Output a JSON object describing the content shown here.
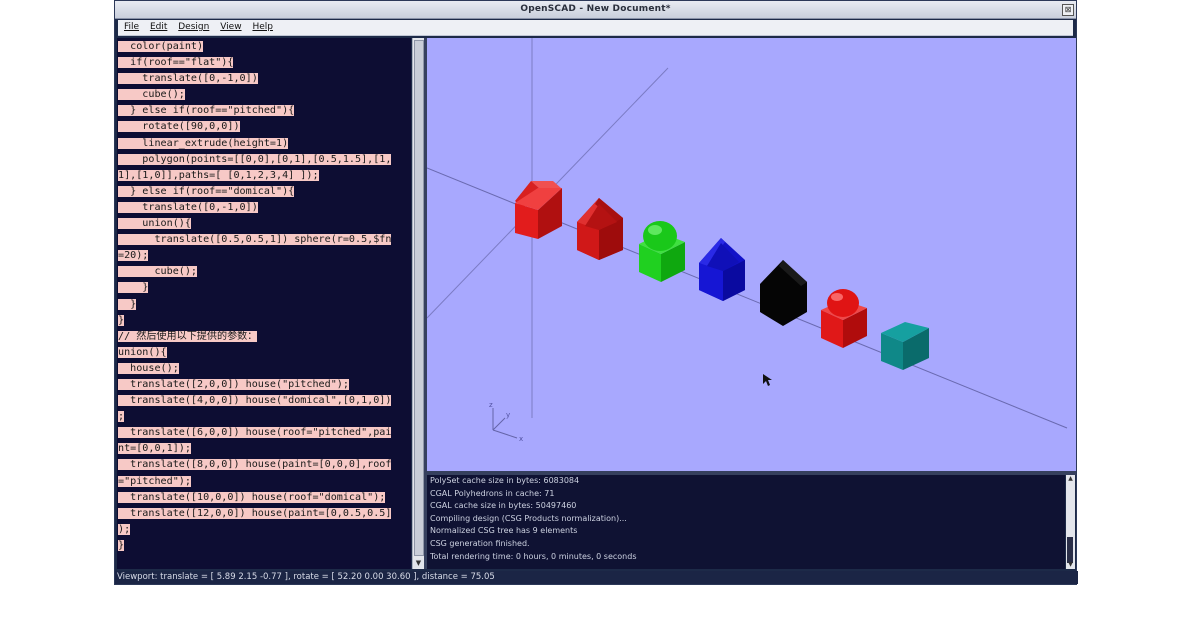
{
  "window": {
    "title": "OpenSCAD - New Document*",
    "close_glyph": "⊠"
  },
  "menu": [
    "File",
    "Edit",
    "Design",
    "View",
    "Help"
  ],
  "editor": {
    "lines": [
      "  color(paint)",
      "  if(roof==\"flat\"){",
      "    translate([0,-1,0])",
      "    cube();",
      "  } else if(roof==\"pitched\"){",
      "    rotate([90,0,0])",
      "    linear_extrude(height=1)",
      "    polygon(points=[[0,0],[0,1],[0.5,1.5],[1,",
      "1],[1,0]],paths=[ [0,1,2,3,4] ]);",
      "  } else if(roof==\"domical\"){",
      "    translate([0,-1,0])",
      "    union(){",
      "      translate([0.5,0.5,1]) sphere(r=0.5,$fn",
      "=20);",
      "      cube();",
      "    }",
      "  }",
      "}",
      "// 然后使用以下提供的参数：",
      "union(){",
      "  house();",
      "  translate([2,0,0]) house(\"pitched\");",
      "  translate([4,0,0]) house(\"domical\",[0,1,0])",
      ";",
      "  translate([6,0,0]) house(roof=\"pitched\",pai",
      "nt=[0,0,1]);",
      "  translate([8,0,0]) house(paint=[0,0,0],roof",
      "=\"pitched\");",
      "  translate([10,0,0]) house(roof=\"domical\");",
      "  translate([12,0,0]) house(paint=[0,0.5,0.5]",
      ");",
      "}"
    ]
  },
  "viewport": {
    "background": "#a8a8fe",
    "axis_labels": {
      "x": "x",
      "y": "y",
      "z": "z"
    },
    "objects": [
      {
        "name": "flat-house-red",
        "roof": "flat",
        "color": "#dd1a1a"
      },
      {
        "name": "pitched-house-red",
        "roof": "pitched",
        "color": "#cc1515"
      },
      {
        "name": "domical-house-green",
        "roof": "domical",
        "color": "#18c818"
      },
      {
        "name": "pitched-house-blue",
        "roof": "pitched",
        "color": "#1010cc"
      },
      {
        "name": "pitched-house-black",
        "roof": "pitched",
        "color": "#060606"
      },
      {
        "name": "domical-house-red",
        "roof": "domical",
        "color": "#e01414"
      },
      {
        "name": "flat-house-teal",
        "roof": "flat",
        "color": "#0d7a7a"
      }
    ]
  },
  "console": {
    "lines": [
      "PolySet cache size in bytes: 6083084",
      "CGAL Polyhedrons in cache: 71",
      "CGAL cache size in bytes: 50497460",
      "Compiling design (CSG Products normalization)...",
      "Normalized CSG tree has 9 elements",
      "CSG generation finished.",
      "Total rendering time: 0 hours, 0 minutes, 0 seconds"
    ]
  },
  "status": {
    "text": "Viewport: translate = [ 5.89 2.15 -0.77 ], rotate = [ 52.20 0.00 30.60 ], distance = 75.05"
  }
}
